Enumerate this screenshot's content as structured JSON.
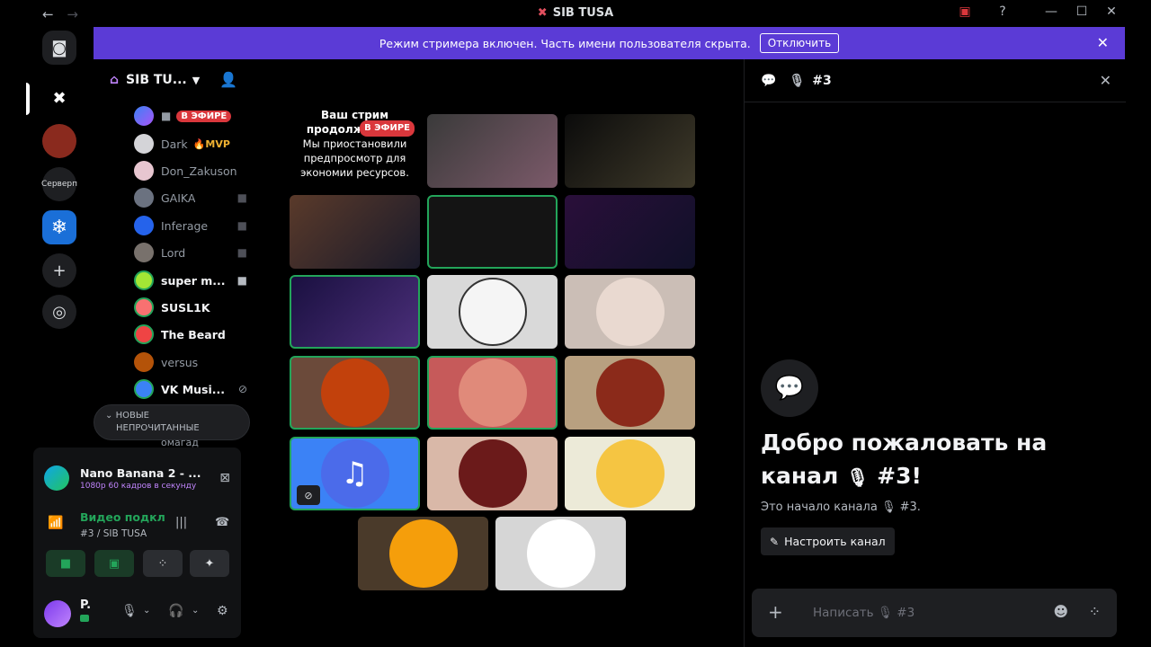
{
  "window": {
    "title": "SIB TUSA",
    "nav_back": "←",
    "nav_forward": "→"
  },
  "banner": {
    "text": "Режим стримера включен. Часть имени пользователя скрыта.",
    "button": "Отключить"
  },
  "rail": {
    "server_text_label": "Серверп"
  },
  "guild": {
    "name": "SIB TU..."
  },
  "members": [
    {
      "name": "",
      "badge": "В ЭФИРЕ"
    },
    {
      "name": "Dark",
      "badge": "🔥MVP"
    },
    {
      "name": "Don_Zakuson"
    },
    {
      "name": "GAIKA"
    },
    {
      "name": "Inferage"
    },
    {
      "name": "Lord"
    },
    {
      "name": "super m..."
    },
    {
      "name": "SUSL1K"
    },
    {
      "name": "The Beard"
    },
    {
      "name": "versus"
    },
    {
      "name": "VK Musi..."
    }
  ],
  "unread": {
    "line1": "НОВЫЕ",
    "line2": "НЕПРОЧИТАННЫЕ",
    "hidden_member": "омагад"
  },
  "activity": {
    "title": "Nano Banana 2 - ...",
    "subtitle": "1080p 60 кадров в секунду"
  },
  "voice": {
    "status": "Видео подключено",
    "channel": "#3 / SIB TUSA"
  },
  "user": {
    "name": "P."
  },
  "grid": {
    "notice_title_1": "Ваш стрим",
    "notice_title_2": "продолжается!",
    "notice_badge": "В ЭФИРЕ",
    "notice_body_1": "Мы приостановили",
    "notice_body_2": "предпросмотр для",
    "notice_body_3": "экономии ресурсов."
  },
  "chat": {
    "channel": "#3",
    "welcome_1": "Добро пожаловать на",
    "welcome_2": "канал",
    "welcome_3": "#3!",
    "start_text": "Это начало канала",
    "start_channel": "#3.",
    "configure": "Настроить канал",
    "placeholder_prefix": "Написать",
    "placeholder_channel": "#3"
  },
  "colors": {
    "accent": "#5b3bd6",
    "speaking": "#23a55a",
    "live": "#da373c"
  }
}
